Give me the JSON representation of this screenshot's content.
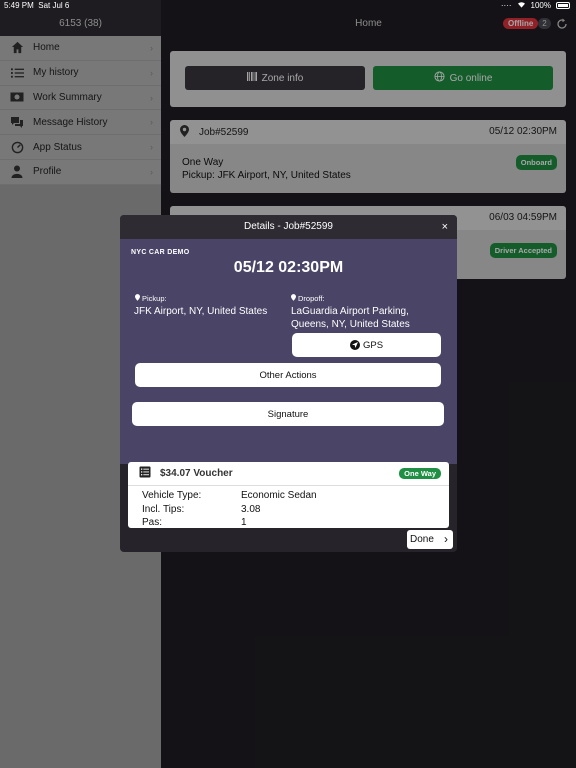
{
  "status_bar": {
    "time": "5:49 PM",
    "date": "Sat Jul 6",
    "battery": "100%"
  },
  "sidebar": {
    "header": "6153 (38)",
    "items": [
      {
        "label": "Home",
        "icon": "home-icon"
      },
      {
        "label": "My history",
        "icon": "list-icon"
      },
      {
        "label": "Work Summary",
        "icon": "money-icon"
      },
      {
        "label": "Message History",
        "icon": "chat-icon"
      },
      {
        "label": "App Status",
        "icon": "gauge-icon"
      },
      {
        "label": "Profile",
        "icon": "person-icon"
      }
    ]
  },
  "header": {
    "title": "Home",
    "status": "Offline",
    "count": "2"
  },
  "zone": {
    "info_label": "Zone info",
    "online_label": "Go online"
  },
  "jobs": [
    {
      "id": "Job#52599",
      "date": "05/12 02:30PM",
      "type": "One Way",
      "pickup": "Pickup: JFK Airport, NY, United States",
      "status": "Onboard"
    },
    {
      "date": "06/03 04:59PM",
      "status": "Driver Accepted"
    }
  ],
  "modal": {
    "title": "Details - Job#52599",
    "close": "×",
    "company": "NYC CAR DEMO",
    "time": "05/12 02:30PM",
    "pickup_label": "Pickup:",
    "pickup": "JFK Airport, NY, United States",
    "dropoff_label": "Dropoff:",
    "dropoff": "LaGuardia Airport Parking, Queens, NY, United States",
    "gps_label": "GPS",
    "other_actions_label": "Other Actions",
    "signature_label": "Signature",
    "voucher": {
      "amount": "$34.07 Voucher",
      "badge": "One Way",
      "rows": [
        {
          "key": "Vehicle Type:",
          "value": "Economic Sedan"
        },
        {
          "key": "Incl. Tips:",
          "value": "3.08"
        },
        {
          "key": "Pas:",
          "value": "1"
        }
      ]
    },
    "done_label": "Done"
  },
  "colors": {
    "offline": "#e0323c",
    "green": "#1f8f43",
    "purple": "#4a4466",
    "dark": "#1f1d22"
  }
}
